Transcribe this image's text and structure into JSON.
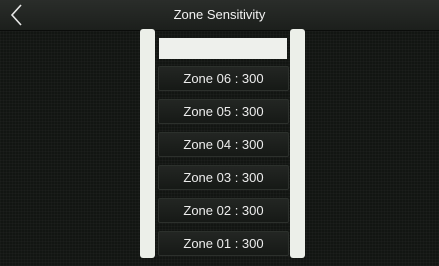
{
  "header": {
    "title": "Zone Sensitivity",
    "back_icon": "chevron-left-icon"
  },
  "zones": [
    {
      "label": "Zone 06 : 300"
    },
    {
      "label": "Zone 05 : 300"
    },
    {
      "label": "Zone 04 : 300"
    },
    {
      "label": "Zone 03 : 300"
    },
    {
      "label": "Zone 02 : 300"
    },
    {
      "label": "Zone 01 : 300"
    }
  ],
  "colors": {
    "background": "#121512",
    "rail": "#ecefe9",
    "text": "#ececec"
  }
}
